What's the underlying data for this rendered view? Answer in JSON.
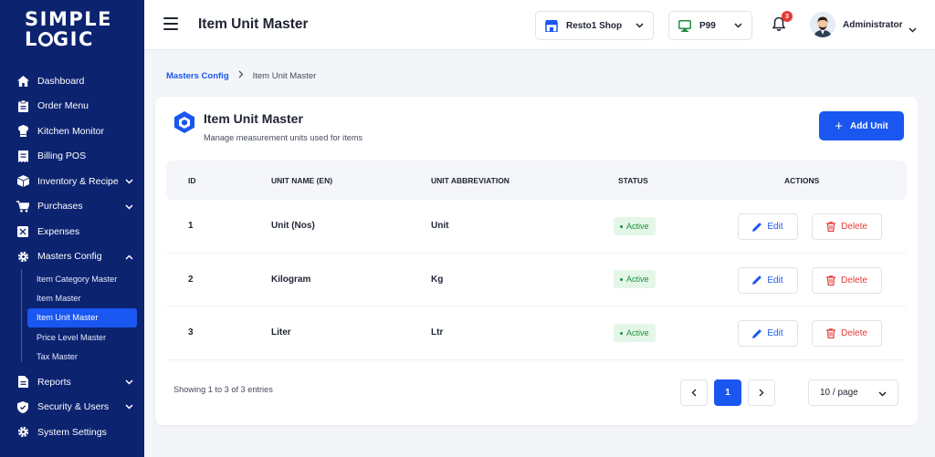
{
  "brand": {
    "line1": "SIMPLE",
    "line2_a": "L",
    "line2_b": "GIC"
  },
  "sidebar": {
    "items": [
      {
        "label": "Dashboard",
        "icon": "home-icon"
      },
      {
        "label": "Order Menu",
        "icon": "clipboard-icon"
      },
      {
        "label": "Kitchen Monitor",
        "icon": "chef-icon"
      },
      {
        "label": "Billing POS",
        "icon": "receipt-icon"
      },
      {
        "label": "Inventory & Recipe",
        "icon": "box-icon"
      },
      {
        "label": "Purchases",
        "icon": "cart-icon"
      },
      {
        "label": "Expenses",
        "icon": "expense-icon"
      },
      {
        "label": "Masters Config",
        "icon": "gear-icon"
      }
    ],
    "sub_items": [
      {
        "label": "Item Category Master"
      },
      {
        "label": "Item Master"
      },
      {
        "label": "Item Unit Master"
      },
      {
        "label": "Price Level Master"
      },
      {
        "label": "Tax Master"
      }
    ],
    "bottom_items": [
      {
        "label": "Reports"
      },
      {
        "label": "Security & Users"
      },
      {
        "label": "System Settings"
      }
    ]
  },
  "topbar": {
    "title": "Item Unit Master",
    "shop": "Resto1 Shop",
    "pos": "P99",
    "notifications": "3",
    "user": "Administrator"
  },
  "breadcrumb": {
    "parent": "Masters Config",
    "current": "Item Unit Master"
  },
  "card": {
    "title": "Item Unit Master",
    "subtitle": "Manage measurement units used for items",
    "add_label": "Add Unit"
  },
  "table": {
    "headers": [
      "ID",
      "UNIT NAME (EN)",
      "UNIT ABBREVIATION",
      "STATUS",
      "ACTIONS"
    ],
    "rows": [
      {
        "id": "1",
        "name": "Unit (Nos)",
        "abbr": "Unit",
        "status": "Active"
      },
      {
        "id": "2",
        "name": "Kilogram",
        "abbr": "Kg",
        "status": "Active"
      },
      {
        "id": "3",
        "name": "Liter",
        "abbr": "Ltr",
        "status": "Active"
      }
    ],
    "edit_label": "Edit",
    "delete_label": "Delete"
  },
  "footer": {
    "showing": "Showing 1 to 3 of 3 entries",
    "page": "1",
    "per_page": "10 / page"
  },
  "colors": {
    "primary": "#1a56f0",
    "sidebar": "#0c2370",
    "danger": "#e53935",
    "success": "#1e8e3e"
  }
}
